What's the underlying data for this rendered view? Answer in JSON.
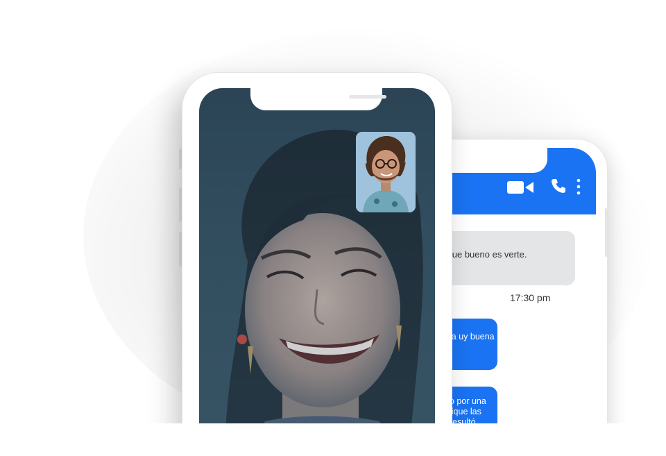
{
  "back_phone": {
    "header": {
      "icons": [
        "video-camera-icon",
        "phone-call-icon",
        "more-vertical-icon"
      ],
      "color": "#1a73f2"
    },
    "messages": [
      {
        "direction": "incoming",
        "text": "estás?, que bueno es verte."
      },
      {
        "direction": "outgoing",
        "text": "la uy buena"
      },
      {
        "direction": "outgoing",
        "text": "o por una lique las resultó."
      }
    ],
    "incoming_time": "17:30 pm"
  },
  "front_phone": {
    "screen": "video-call",
    "remote_participant": "woman-smiling-video",
    "self_view": "man-with-glasses-thumbnail"
  },
  "colors": {
    "accent_blue": "#1a73f2",
    "incoming_bubble": "#e4e5e7",
    "video_tint": "#2c4454"
  }
}
